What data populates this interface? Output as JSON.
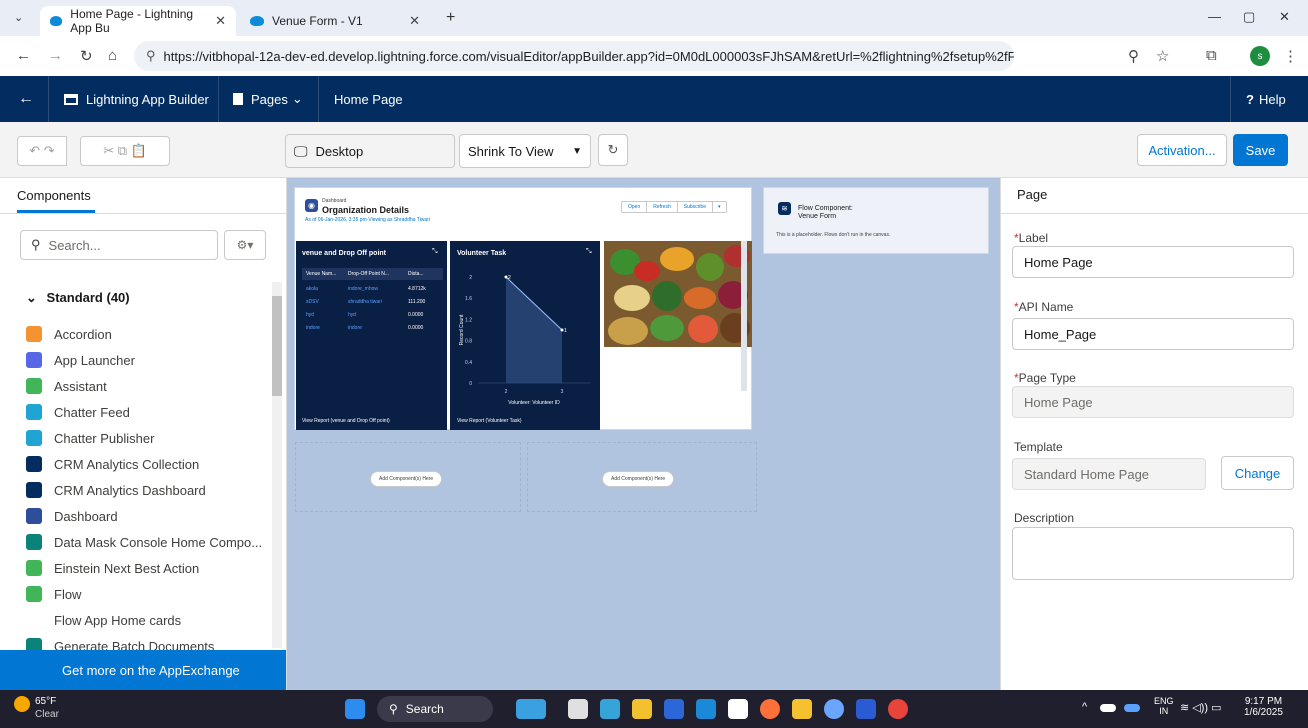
{
  "browser": {
    "tabs": [
      {
        "label": "Home Page - Lightning App Bu",
        "active": true
      },
      {
        "label": "Venue Form - V1",
        "active": false
      }
    ],
    "new_tab": "+",
    "url": "https://vitbhopal-12a-dev-ed.develop.lightning.force.com/visualEditor/appBuilder.app?id=0M0dL000003sFJhSAM&retUrl=%2flightning%2fsetup%2fFlexiPageList%2fpage%3f%26ad...",
    "profile_initial": "s"
  },
  "header": {
    "app_title": "Lightning App Builder",
    "pages_menu": "Pages",
    "page_name": "Home Page",
    "help": "Help"
  },
  "toolbar": {
    "device": "Desktop",
    "zoom": "Shrink To View",
    "activation": "Activation...",
    "save": "Save"
  },
  "left": {
    "tab": "Components",
    "search_placeholder": "Search...",
    "section": "Standard (40)",
    "items": [
      {
        "label": "Accordion",
        "icon": "accordion-icon",
        "color": "#f59331"
      },
      {
        "label": "App Launcher",
        "icon": "app-launcher-icon",
        "color": "#5867e8"
      },
      {
        "label": "Assistant",
        "icon": "assistant-icon",
        "color": "#41b658"
      },
      {
        "label": "Chatter Feed",
        "icon": "chatter-feed-icon",
        "color": "#1fa4d3"
      },
      {
        "label": "Chatter Publisher",
        "icon": "chatter-publisher-icon",
        "color": "#1fa4d3"
      },
      {
        "label": "CRM Analytics Collection",
        "icon": "crm-analytics-icon",
        "color": "#032d60"
      },
      {
        "label": "CRM Analytics Dashboard",
        "icon": "crm-analytics-icon",
        "color": "#032d60"
      },
      {
        "label": "Dashboard",
        "icon": "dashboard-icon",
        "color": "#2e4d9b"
      },
      {
        "label": "Data Mask Console Home Compo...",
        "icon": "data-mask-icon",
        "color": "#0b827c"
      },
      {
        "label": "Einstein Next Best Action",
        "icon": "einstein-icon",
        "color": "#41b658"
      },
      {
        "label": "Flow",
        "icon": "flow-icon",
        "color": "#41b658"
      },
      {
        "label": "Flow App Home cards",
        "icon": "",
        "color": ""
      },
      {
        "label": "Generate Batch Documents",
        "icon": "generate-docs-icon",
        "color": "#0b827c"
      }
    ],
    "appexchange": "Get more on the AppExchange"
  },
  "canvas": {
    "dashboard": {
      "type_label": "Dashboard",
      "title": "Organization Details",
      "subtitle": "As of 06-Jan-2026, 3:35 pm·Viewing as Shraddha Tiwari",
      "buttons": [
        "Open",
        "Refresh",
        "Subscribe"
      ],
      "widget1": {
        "title": "venue and Drop Off point",
        "columns": [
          "Venue Nam...",
          "Drop-Off Point N...",
          "Dista..."
        ],
        "rows": [
          [
            "akola",
            "indore_mhow",
            "4.8712k"
          ],
          [
            "sDSV",
            "shraddha tiwari",
            "111.200"
          ],
          [
            "hyd",
            "hyd",
            "0.0000"
          ],
          [
            "indore",
            "indore",
            "0.0000"
          ]
        ],
        "footer": "View Report (venue and Drop Off point)"
      },
      "widget2": {
        "title": "Volunteer Task",
        "ylabel": "Record Count",
        "xlabel": "Volunteer: Volunteer ID",
        "footer": "View Report (Volunteer Task)"
      }
    },
    "flow": {
      "title": "Flow Component:",
      "name": "Venue Form",
      "note": "This is a placeholder. Flows don't run in the canvas."
    },
    "add_here": "Add Component(s) Here"
  },
  "chart_data": {
    "type": "line",
    "categories": [
      "2",
      "3"
    ],
    "values": [
      2,
      1
    ],
    "xlabel": "Volunteer: Volunteer ID",
    "ylabel": "Record Count",
    "ylim": [
      0,
      2
    ],
    "yticks": [
      "0",
      "0.4",
      "0.8",
      "1.2",
      "1.6",
      "2"
    ],
    "point_labels": [
      "2",
      "1"
    ]
  },
  "right": {
    "title": "Page",
    "label_label": "Label",
    "label_value": "Home Page",
    "api_label": "API Name",
    "api_value": "Home_Page",
    "type_label": "Page Type",
    "type_value": "Home Page",
    "template_label": "Template",
    "template_value": "Standard Home Page",
    "change": "Change",
    "description_label": "Description"
  },
  "taskbar": {
    "weather_temp": "65°F",
    "weather_desc": "Clear",
    "search": "Search",
    "lang": "ENG",
    "region": "IN",
    "time": "9:17 PM",
    "date": "1/6/2025"
  }
}
